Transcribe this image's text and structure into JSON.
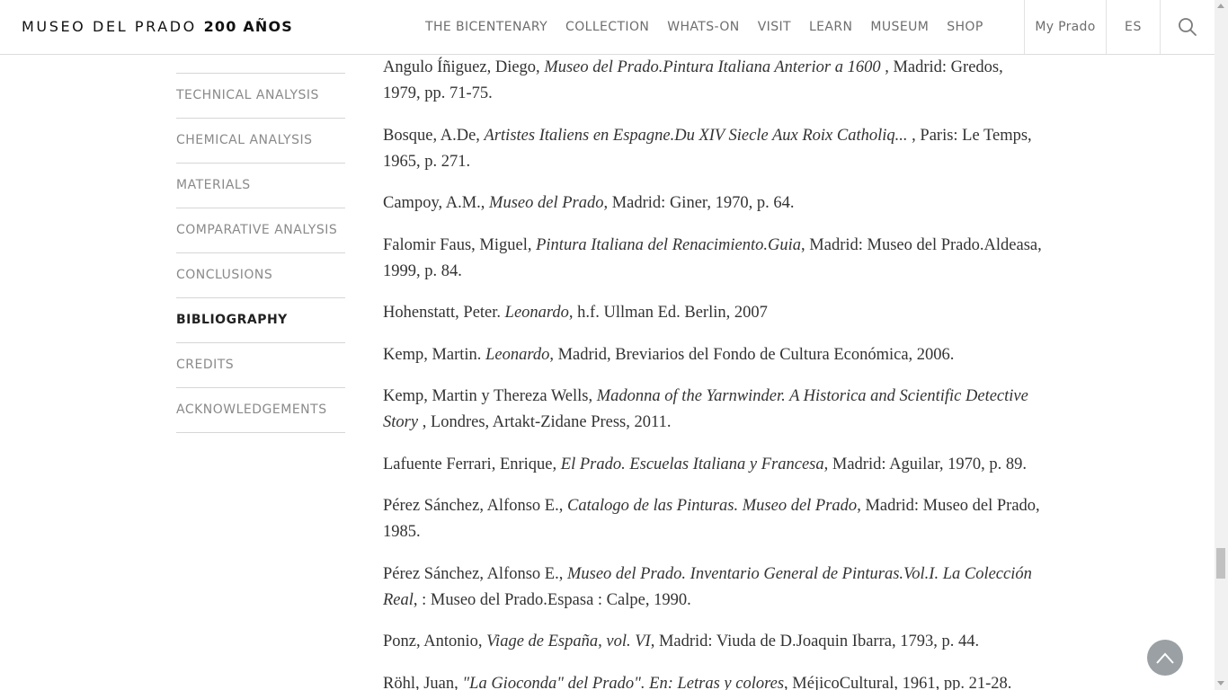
{
  "header": {
    "logo_text": "MUSEO DEL PRADO",
    "logo_bold": "200 AÑOS",
    "nav": [
      "THE BICENTENARY",
      "COLLECTION",
      "WHATS-ON",
      "VISIT",
      "LEARN",
      "MUSEUM",
      "SHOP"
    ],
    "my_prado": "My Prado",
    "language": "ES",
    "search_icon": "search-icon"
  },
  "sidebar": {
    "items": [
      {
        "label": "TECHNICAL ANALYSIS"
      },
      {
        "label": "CHEMICAL ANALYSIS"
      },
      {
        "label": "MATERIALS"
      },
      {
        "label": "COMPARATIVE ANALYSIS"
      },
      {
        "label": "CONCLUSIONS"
      },
      {
        "label": "BIBLIOGRAPHY",
        "active": true
      },
      {
        "label": "CREDITS"
      },
      {
        "label": "ACKNOWLEDGEMENTS"
      }
    ]
  },
  "bibliography": [
    {
      "author": "Angulo Íñiguez, Diego, ",
      "title": "Museo del Prado.Pintura Italiana Anterior a 1600",
      "rest": " , Madrid: Gredos, 1979, pp. 71-75."
    },
    {
      "author": "Bosque, A.De, ",
      "title": "Artistes Italiens en Espagne.Du XIV Siecle Aux Roix Catholiq...",
      "rest": " , Paris: Le Temps, 1965, p. 271."
    },
    {
      "author": "Campoy, A.M., ",
      "title": "Museo del Prado",
      "rest": ", Madrid: Giner, 1970, p. 64."
    },
    {
      "author": "Falomir Faus, Miguel, ",
      "title": "Pintura Italiana del Renacimiento.Guia",
      "rest": ", Madrid: Museo del Prado.Aldeasa, 1999, p. 84."
    },
    {
      "author": "Hohenstatt, Peter. ",
      "title": "Leonardo",
      "rest": ", h.f. Ullman Ed. Berlin, 2007"
    },
    {
      "author": "Kemp, Martin. ",
      "title": "Leonardo",
      "rest": ", Madrid, Breviarios del Fondo de Cultura Económica, 2006."
    },
    {
      "author": "Kemp, Martin y Thereza Wells, ",
      "title": "Madonna of the Yarnwinder. A Historica and Scientific Detective Story",
      "rest": " , Londres, Artakt-Zidane Press, 2011."
    },
    {
      "author": "Lafuente Ferrari, Enrique, ",
      "title": "El Prado. Escuelas Italiana y Francesa",
      "rest": ", Madrid: Aguilar, 1970, p. 89."
    },
    {
      "author": "Pérez Sánchez, Alfonso E., ",
      "title": "Catalogo de las Pinturas. Museo del Prado",
      "rest": ", Madrid: Museo del Prado, 1985."
    },
    {
      "author": "Pérez Sánchez, Alfonso E., ",
      "title": "Museo del Prado. Inventario General de Pinturas.Vol.I. La Colección Real",
      "rest": ", : Museo del Prado.Espasa : Calpe, 1990."
    },
    {
      "author": "Ponz, Antonio, ",
      "title": "Viage de España, vol. VI",
      "rest": ", Madrid: Viuda de D.Joaquin Ibarra, 1793, p. 44."
    },
    {
      "author": "Röhl, Juan, ",
      "title": "\"La Gioconda\" del Prado\". En: Letras y colores",
      "rest": ", MéjicoCultural, 1961, pp. 21-28."
    }
  ],
  "back_to_top_icon": "chevron-up-icon",
  "colors": {
    "text": "#333333",
    "nav": "#6e6e6e",
    "sidebar": "#8a8a8a",
    "to_top": "#9aa0a3"
  }
}
